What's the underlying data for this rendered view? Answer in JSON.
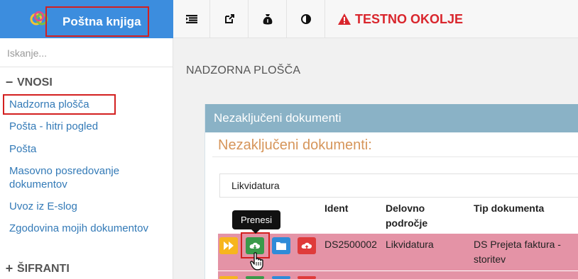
{
  "sidebar": {
    "brand_title": "Poštna knjiga",
    "search_placeholder": "Iskanje...",
    "sections": [
      {
        "symbol": "−",
        "label": "VNOSI",
        "expanded": true
      },
      {
        "symbol": "+",
        "label": "ŠIFRANTI",
        "expanded": false
      }
    ],
    "items": [
      {
        "label": "Nadzorna plošča",
        "active": true
      },
      {
        "label": "Pošta - hitri pogled"
      },
      {
        "label": "Pošta"
      },
      {
        "label": "Masovno posredovanje dokumentov"
      },
      {
        "label": "Uvoz iz E-slog"
      },
      {
        "label": "Zgodovina mojih dokumentov"
      }
    ]
  },
  "topbar": {
    "icons": [
      "list-icon",
      "external-link-icon",
      "money-bag-icon",
      "contrast-icon"
    ],
    "warning_label": "TESTNO OKOLJE"
  },
  "main": {
    "page_title": "NADZORNA PLOŠČA",
    "panel": {
      "header": "Nezaključeni dokumenti",
      "subtitle": "Nezaključeni dokumenti:",
      "tab": "Likvidatura",
      "columns": [
        "Ident",
        "Delovno področje",
        "Tip dokumenta"
      ],
      "rows": [
        {
          "ident": "DS2500002",
          "delovno_podrocje": "Likvidatura",
          "tip_dokumenta": "DS Prejeta faktura - storitev"
        }
      ],
      "tooltip": "Prenesi"
    }
  },
  "colors": {
    "brand_blue": "#3c8dde",
    "panel_header": "#8ab2c6",
    "subtitle_orange": "#d6955a",
    "row_pink": "#e493a6",
    "warning_red": "#d9262d",
    "highlight_red": "#d32020"
  }
}
